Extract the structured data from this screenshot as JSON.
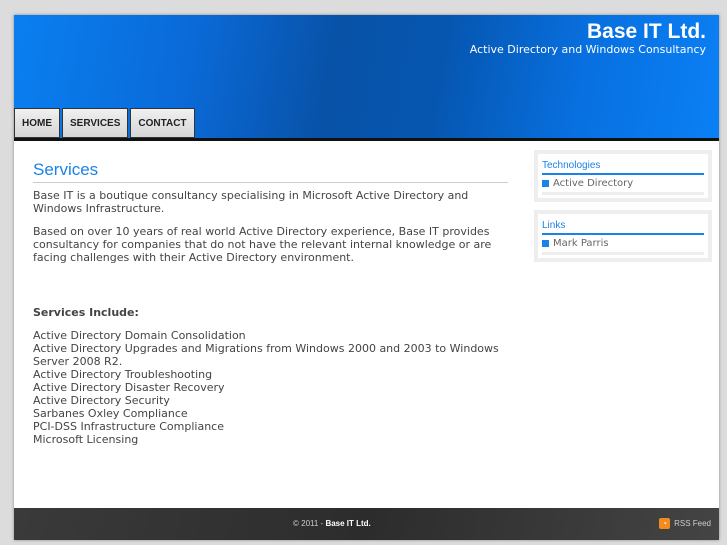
{
  "header": {
    "title": "Base IT Ltd.",
    "subtitle": "Active Directory and Windows Consultancy"
  },
  "nav": [
    {
      "label": "HOME"
    },
    {
      "label": "SERVICES"
    },
    {
      "label": "CONTACT"
    }
  ],
  "main": {
    "heading": "Services",
    "paragraphs": [
      "Base IT is a boutique consultancy specialising in Microsoft Active Directory and Windows Infrastructure.",
      "Based on over 10 years of  real world Active Directory experience, Base IT provides consultancy for companies that  do not have the relevant internal knowledge or are facing challenges with their Active Directory environment."
    ],
    "services_heading": "Services Include:",
    "services": [
      "Active Directory Domain Consolidation",
      "Active Directory Upgrades and Migrations from Windows 2000 and 2003 to Windows Server 2008 R2.",
      "Active Directory Troubleshooting",
      "Active Directory Disaster Recovery",
      "Active Directory Security",
      "Sarbanes Oxley Compliance",
      "PCI-DSS Infrastructure Compliance",
      "Microsoft Licensing"
    ]
  },
  "sidebar": {
    "technologies": {
      "title": "Technologies",
      "items": [
        "Active Directory"
      ]
    },
    "links": {
      "title": "Links",
      "items": [
        "Mark Parris"
      ]
    }
  },
  "footer": {
    "copyright": "© 2011 - ",
    "company": "Base IT Ltd.",
    "rss": "RSS Feed"
  }
}
